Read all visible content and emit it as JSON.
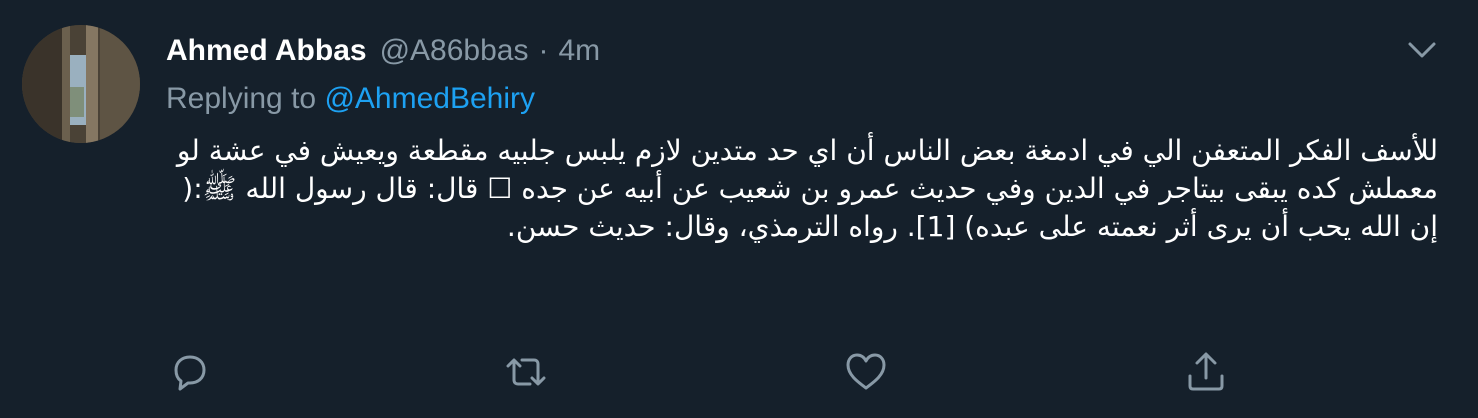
{
  "tweet": {
    "display_name": "Ahmed Abbas",
    "handle": "@A86bbas",
    "separator": "·",
    "time": "4m",
    "replying_prefix": "Replying to ",
    "replying_to": "@AhmedBehiry",
    "body": "للأسف الفكر المتعفن الي في ادمغة بعض الناس أن اي حد متدين لازم يلبس جلبيه مقطعة ويعيش في عشة لو معملش كده يبقى بيتاجر في الدين وفي حديث عمرو بن شعيب عن أبيه عن جده ☐ قال: قال رسول الله ﷺ:( إن الله يحب أن يرى أثر نعمته على عبده) [1]. رواه الترمذي، وقال: حديث حسن."
  },
  "icons": {
    "caret": "chevron-down-icon",
    "reply": "reply-icon",
    "retweet": "retweet-icon",
    "like": "heart-icon",
    "share": "share-icon"
  },
  "colors": {
    "background": "#15202b",
    "primary_text": "#ffffff",
    "secondary_text": "#8899a6",
    "link": "#1da1f2"
  }
}
